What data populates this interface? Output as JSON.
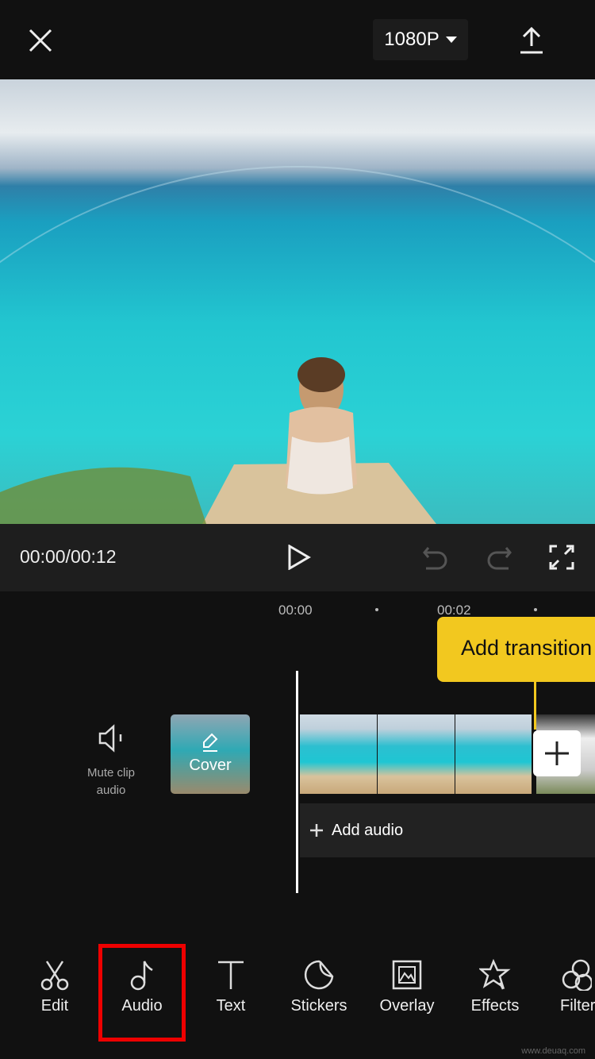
{
  "header": {
    "resolution": "1080P",
    "close_icon": "close-icon",
    "export_icon": "upload-icon"
  },
  "player": {
    "time": "00:00/00:12",
    "icons": [
      "play-icon",
      "undo-icon",
      "redo-icon",
      "fullscreen-icon"
    ]
  },
  "timeline": {
    "ruler": [
      "00:00",
      "00:02"
    ],
    "tooltip": "Add transition",
    "mute_label_1": "Mute clip",
    "mute_label_2": "audio",
    "cover": "Cover",
    "add_audio": "Add audio"
  },
  "toolbar": {
    "items": [
      {
        "label": "Edit",
        "icon": "scissors-icon"
      },
      {
        "label": "Audio",
        "icon": "music-note-icon"
      },
      {
        "label": "Text",
        "icon": "text-icon"
      },
      {
        "label": "Stickers",
        "icon": "sticker-icon"
      },
      {
        "label": "Overlay",
        "icon": "overlay-icon"
      },
      {
        "label": "Effects",
        "icon": "star-icon"
      },
      {
        "label": "Filters",
        "icon": "filter-icon"
      }
    ],
    "highlighted": "Audio"
  },
  "watermark": "www.deuaq.com",
  "colors": {
    "accent": "#f2c81f",
    "highlight": "#e00000"
  }
}
